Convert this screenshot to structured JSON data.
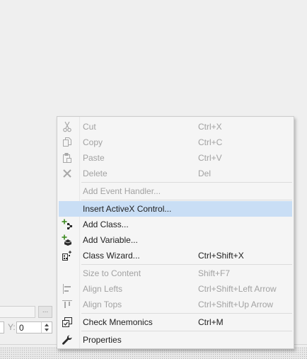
{
  "background": {
    "y_label": "Y:",
    "y_value": "0",
    "ellipsis_label": "..."
  },
  "menu": {
    "groups": [
      {
        "items": [
          {
            "label": "Cut",
            "shortcut": "Ctrl+X",
            "icon": "scissors-icon",
            "enabled": false
          },
          {
            "label": "Copy",
            "shortcut": "Ctrl+C",
            "icon": "copy-icon",
            "enabled": false
          },
          {
            "label": "Paste",
            "shortcut": "Ctrl+V",
            "icon": "paste-icon",
            "enabled": false
          },
          {
            "label": "Delete",
            "shortcut": "Del",
            "icon": "delete-x-icon",
            "enabled": false
          }
        ]
      },
      {
        "items": [
          {
            "label": "Add Event Handler...",
            "shortcut": "",
            "icon": "",
            "enabled": false
          }
        ]
      },
      {
        "items": [
          {
            "label": "Insert ActiveX Control...",
            "shortcut": "",
            "icon": "",
            "enabled": true,
            "highlighted": true
          },
          {
            "label": "Add Class...",
            "shortcut": "",
            "icon": "add-class-icon",
            "enabled": true
          },
          {
            "label": "Add Variable...",
            "shortcut": "",
            "icon": "add-variable-icon",
            "enabled": true
          },
          {
            "label": "Class Wizard...",
            "shortcut": "Ctrl+Shift+X",
            "icon": "class-wizard-icon",
            "enabled": true
          }
        ]
      },
      {
        "items": [
          {
            "label": "Size to Content",
            "shortcut": "Shift+F7",
            "icon": "",
            "enabled": false
          },
          {
            "label": "Align Lefts",
            "shortcut": "Ctrl+Shift+Left Arrow",
            "icon": "align-lefts-icon",
            "enabled": false
          },
          {
            "label": "Align Tops",
            "shortcut": "Ctrl+Shift+Up Arrow",
            "icon": "align-tops-icon",
            "enabled": false
          }
        ]
      },
      {
        "items": [
          {
            "label": "Check Mnemonics",
            "shortcut": "Ctrl+M",
            "icon": "check-mnemonics-icon",
            "enabled": true
          }
        ]
      },
      {
        "items": [
          {
            "label": "Properties",
            "shortcut": "",
            "icon": "wrench-icon",
            "enabled": true
          }
        ]
      }
    ]
  },
  "colors": {
    "highlight": "#c9def5",
    "disabled_text": "#a2a2a2",
    "enabled_text": "#1e1e1e",
    "add_green": "#3c8a1f"
  }
}
